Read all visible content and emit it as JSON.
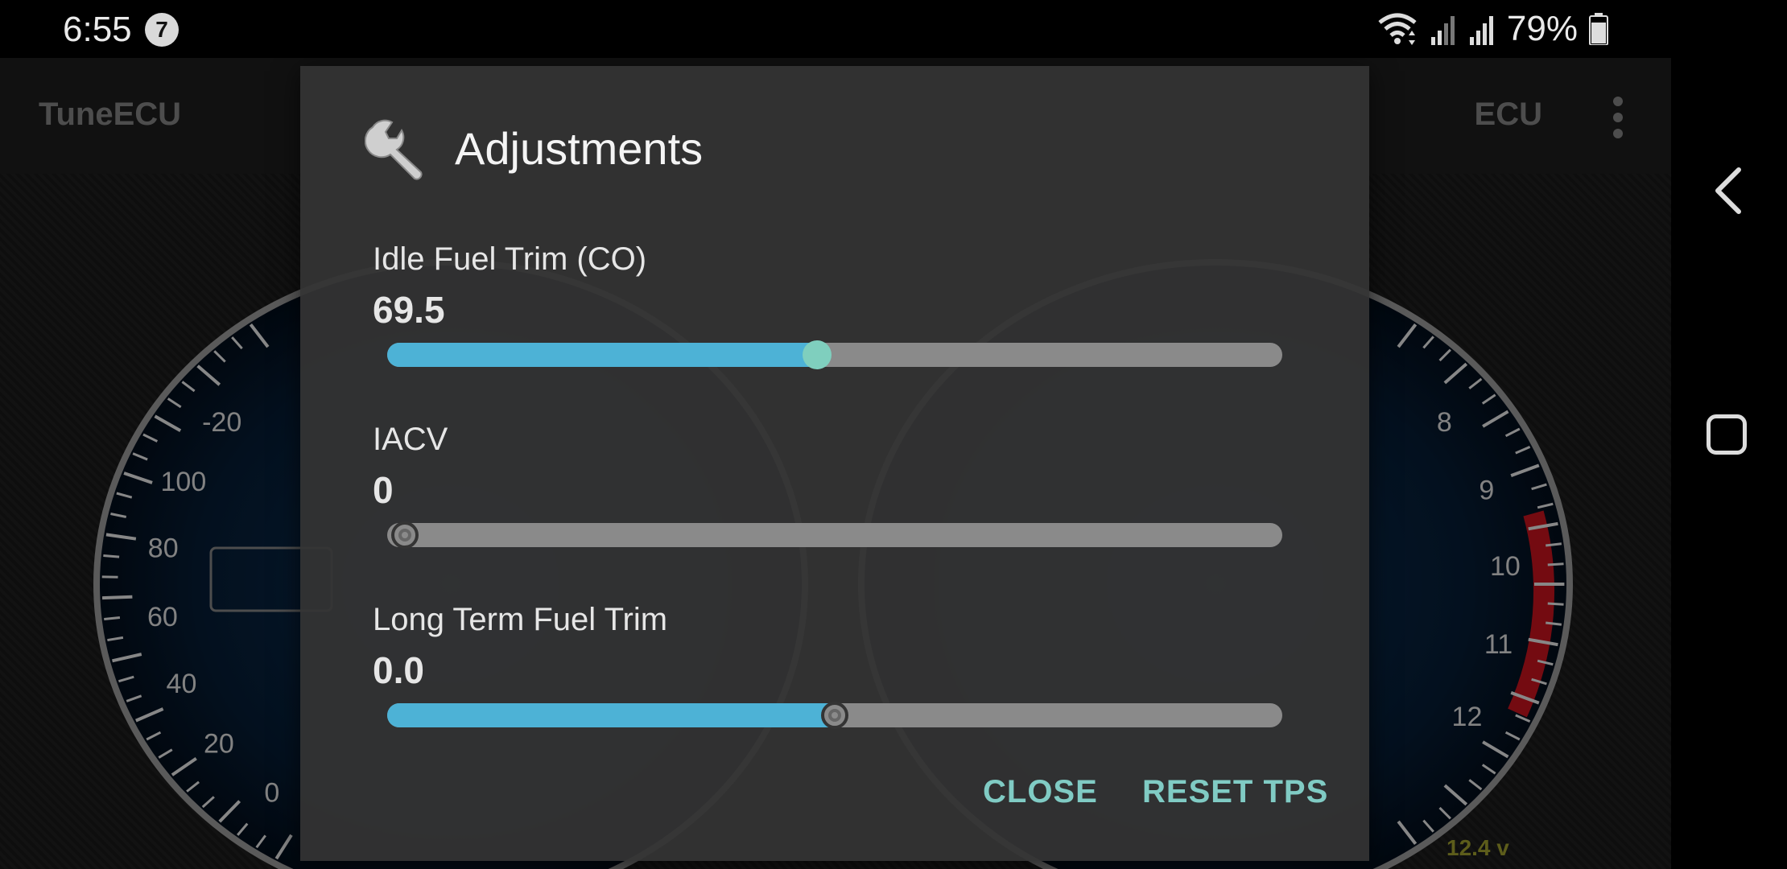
{
  "status_bar": {
    "time": "6:55",
    "notification_count": "7",
    "battery_percent": "79%",
    "icons": [
      "wifi-icon",
      "signal-icon-1",
      "signal-icon-2",
      "battery-icon"
    ]
  },
  "app_bar": {
    "title": "TuneECU",
    "ecu_label": "ECU",
    "menu_icon": "more-vert-icon"
  },
  "dashboard": {
    "voltage": "12.4 v",
    "left_gauge_ticks": [
      "-20",
      "100",
      "80",
      "60",
      "40",
      "20",
      "0"
    ],
    "right_gauge_ticks": [
      "8",
      "9",
      "10",
      "11",
      "12"
    ]
  },
  "dialog": {
    "icon": "wrench-icon",
    "title": "Adjustments",
    "items": [
      {
        "label": "Idle Fuel Trim (CO)",
        "value": "69.5",
        "fraction": 0.48,
        "fill": true
      },
      {
        "label": "IACV",
        "value": "0",
        "fraction": 0.02,
        "fill": false
      },
      {
        "label": "Long Term Fuel Trim",
        "value": "0.0",
        "fraction": 0.5,
        "fill": true
      }
    ],
    "close_label": "CLOSE",
    "reset_label": "RESET TPS"
  },
  "colors": {
    "accent": "#80cbc4",
    "slider_fill": "#4db2d6",
    "slider_track": "#8a8a8a",
    "redline": "#b3121b"
  }
}
